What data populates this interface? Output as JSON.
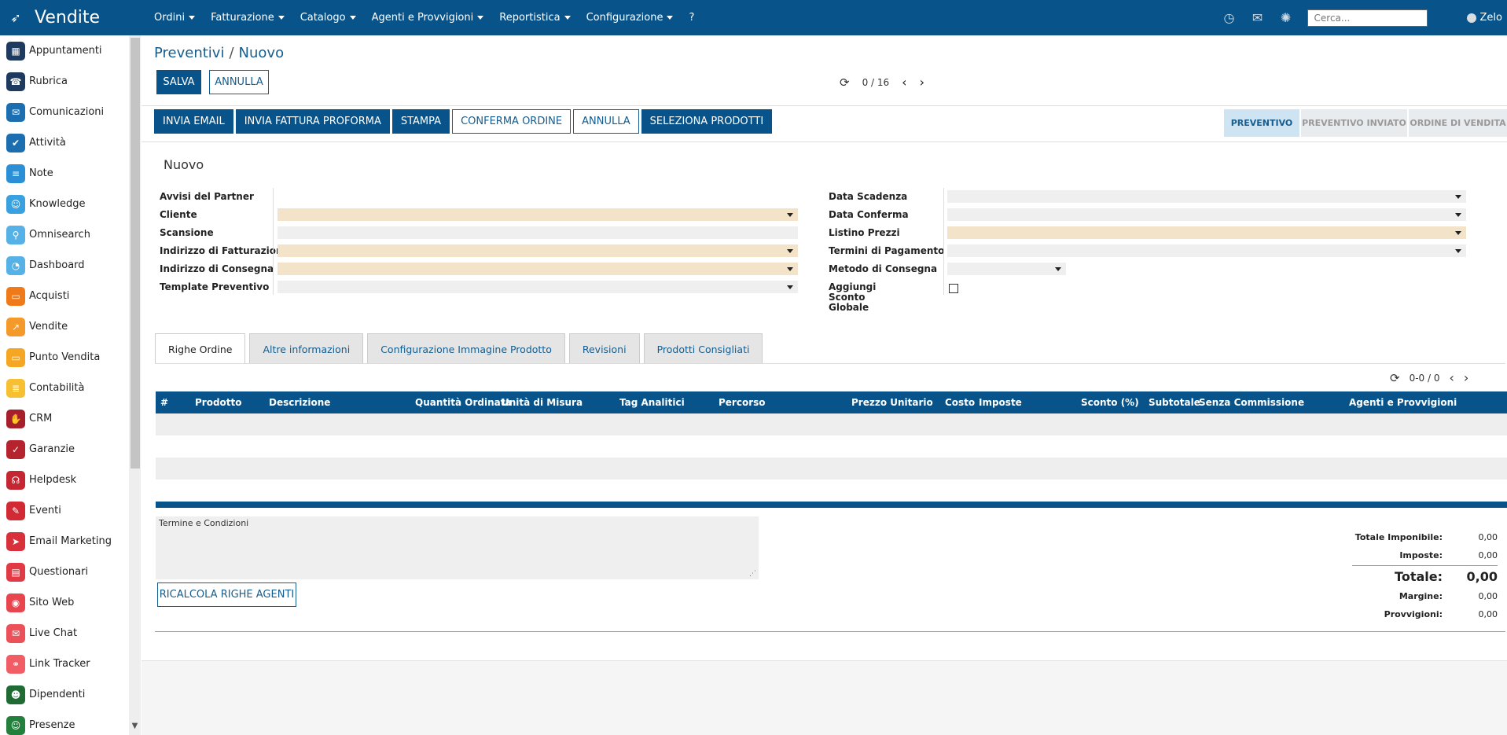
{
  "topnav": {
    "app_title": "Vendite",
    "menu": [
      {
        "label": "Ordini",
        "caret": true
      },
      {
        "label": "Fatturazione",
        "caret": true
      },
      {
        "label": "Catalogo",
        "caret": true
      },
      {
        "label": "Agenti e Provvigioni",
        "caret": true
      },
      {
        "label": "Reportistica",
        "caret": true
      },
      {
        "label": "Configurazione",
        "caret": true
      },
      {
        "label": "?",
        "caret": false
      }
    ],
    "search_placeholder": "Cerca...",
    "user_name": "Zelo",
    "icons": [
      "clock-icon",
      "chat-icon",
      "spinner-icon"
    ]
  },
  "sidebar": {
    "items": [
      {
        "label": "Appuntamenti",
        "icon": "calendar-icon",
        "color": "#1f3a5f",
        "glyph": "▦"
      },
      {
        "label": "Rubrica",
        "icon": "contacts-icon",
        "color": "#1f3a5f",
        "glyph": "☎"
      },
      {
        "label": "Comunicazioni",
        "icon": "message-icon",
        "color": "#1b6fb0",
        "glyph": "✉"
      },
      {
        "label": "Attività",
        "icon": "check-icon",
        "color": "#1b6fb0",
        "glyph": "✔"
      },
      {
        "label": "Note",
        "icon": "note-icon",
        "color": "#2b8fd6",
        "glyph": "≡"
      },
      {
        "label": "Knowledge",
        "icon": "knowledge-icon",
        "color": "#3aa1e0",
        "glyph": "☺"
      },
      {
        "label": "Omnisearch",
        "icon": "search-icon",
        "color": "#56b2e6",
        "glyph": "⚲"
      },
      {
        "label": "Dashboard",
        "icon": "dashboard-icon",
        "color": "#56b2e6",
        "glyph": "◔"
      },
      {
        "label": "Acquisti",
        "icon": "card-icon",
        "color": "#f07a1a",
        "glyph": "▭"
      },
      {
        "label": "Vendite",
        "icon": "chart-icon",
        "color": "#f39a2a",
        "glyph": "↗"
      },
      {
        "label": "Punto Vendita",
        "icon": "monitor-icon",
        "color": "#f5a623",
        "glyph": "▭"
      },
      {
        "label": "Contabilità",
        "icon": "ledger-icon",
        "color": "#f7c033",
        "glyph": "≣"
      },
      {
        "label": "CRM",
        "icon": "handshake-icon",
        "color": "#a61f2a",
        "glyph": "✋"
      },
      {
        "label": "Garanzie",
        "icon": "shield-icon",
        "color": "#b5232e",
        "glyph": "✓"
      },
      {
        "label": "Helpdesk",
        "icon": "headset-icon",
        "color": "#c42632",
        "glyph": "☊"
      },
      {
        "label": "Eventi",
        "icon": "ticket-icon",
        "color": "#d12a35",
        "glyph": "✎"
      },
      {
        "label": "Email Marketing",
        "icon": "paperplane-icon",
        "color": "#d9313c",
        "glyph": "➤"
      },
      {
        "label": "Questionari",
        "icon": "clipboard-icon",
        "color": "#e23a44",
        "glyph": "▤"
      },
      {
        "label": "Sito Web",
        "icon": "globe-icon",
        "color": "#e8454e",
        "glyph": "◉"
      },
      {
        "label": "Live Chat",
        "icon": "chat-bubble-icon",
        "color": "#ec5058",
        "glyph": "✉"
      },
      {
        "label": "Link Tracker",
        "icon": "link-icon",
        "color": "#f05d64",
        "glyph": "⚭"
      },
      {
        "label": "Dipendenti",
        "icon": "people-icon",
        "color": "#1f6b33",
        "glyph": "☻"
      },
      {
        "label": "Presenze",
        "icon": "person-icon",
        "color": "#23803c",
        "glyph": "☺"
      }
    ]
  },
  "breadcrumb": {
    "parent": "Preventivi",
    "separator": "/",
    "current": "Nuovo"
  },
  "actions": {
    "save": "SALVA",
    "discard": "ANNULLA"
  },
  "pager": {
    "value": "0 / 16"
  },
  "header_buttons": [
    {
      "label": "INVIA EMAIL",
      "style": "dark"
    },
    {
      "label": "INVIA FATTURA PROFORMA",
      "style": "dark"
    },
    {
      "label": "STAMPA",
      "style": "dark"
    },
    {
      "label": "CONFERMA ORDINE",
      "style": "light"
    },
    {
      "label": "ANNULLA",
      "style": "light"
    },
    {
      "label": "SELEZIONA PRODOTTI",
      "style": "dark"
    }
  ],
  "status_stages": [
    {
      "label": "PREVENTIVO",
      "active": true
    },
    {
      "label": "PREVENTIVO INVIATO",
      "active": false
    },
    {
      "label": "ORDINE DI VENDITA",
      "active": false
    }
  ],
  "form": {
    "title": "Nuovo",
    "left_fields": [
      {
        "label": "Avvisi del Partner",
        "required": false,
        "dropdown": false,
        "has_input": false
      },
      {
        "label": "Cliente",
        "required": true,
        "dropdown": true,
        "has_input": true
      },
      {
        "label": "Scansione",
        "required": false,
        "dropdown": false,
        "has_input": true
      },
      {
        "label": "Indirizzo di Fatturazione",
        "required": true,
        "dropdown": true,
        "has_input": true
      },
      {
        "label": "Indirizzo di Consegna",
        "required": true,
        "dropdown": true,
        "has_input": true
      },
      {
        "label": "Template Preventivo",
        "required": false,
        "dropdown": true,
        "has_input": true
      }
    ],
    "right_fields": [
      {
        "label": "Data Scadenza",
        "required": false,
        "dropdown": true
      },
      {
        "label": "Data Conferma",
        "required": false,
        "dropdown": true
      },
      {
        "label": "Listino Prezzi",
        "required": true,
        "dropdown": true
      },
      {
        "label": "Termini di Pagamento",
        "required": false,
        "dropdown": true
      },
      {
        "label": "Metodo di Consegna",
        "required": false,
        "dropdown": true
      },
      {
        "label": "Aggiungi Sconto Globale",
        "required": false,
        "checkbox": true,
        "checked": false
      }
    ]
  },
  "tabs": [
    {
      "label": "Righe Ordine",
      "active": true
    },
    {
      "label": "Altre informazioni",
      "active": false
    },
    {
      "label": "Configurazione Immagine Prodotto",
      "active": false
    },
    {
      "label": "Revisioni",
      "active": false
    },
    {
      "label": "Prodotti Consigliati",
      "active": false
    }
  ],
  "order_lines": {
    "pager": "0-0 / 0",
    "columns": [
      "#",
      "Prodotto",
      "Descrizione",
      "Quantità Ordinata",
      "Unità di Misura",
      "Tag Analitici",
      "Percorso",
      "Prezzo Unitario",
      "Costo",
      "Imposte",
      "Sconto (%)",
      "Subtotale",
      "Senza Commissione",
      "Agenti e Provvigioni"
    ],
    "rows": []
  },
  "terms_placeholder": "Termine e Condizioni",
  "recalc_button": "RICALCOLA RIGHE AGENTI",
  "totals": {
    "imponibile_label": "Totale Imponibile:",
    "imponibile": "0,00",
    "imposte_label": "Imposte:",
    "imposte": "0,00",
    "totale_label": "Totale:",
    "totale": "0,00",
    "margine_label": "Margine:",
    "margine": "0,00",
    "provvigioni_label": "Provvigioni:",
    "provvigioni": "0,00"
  }
}
